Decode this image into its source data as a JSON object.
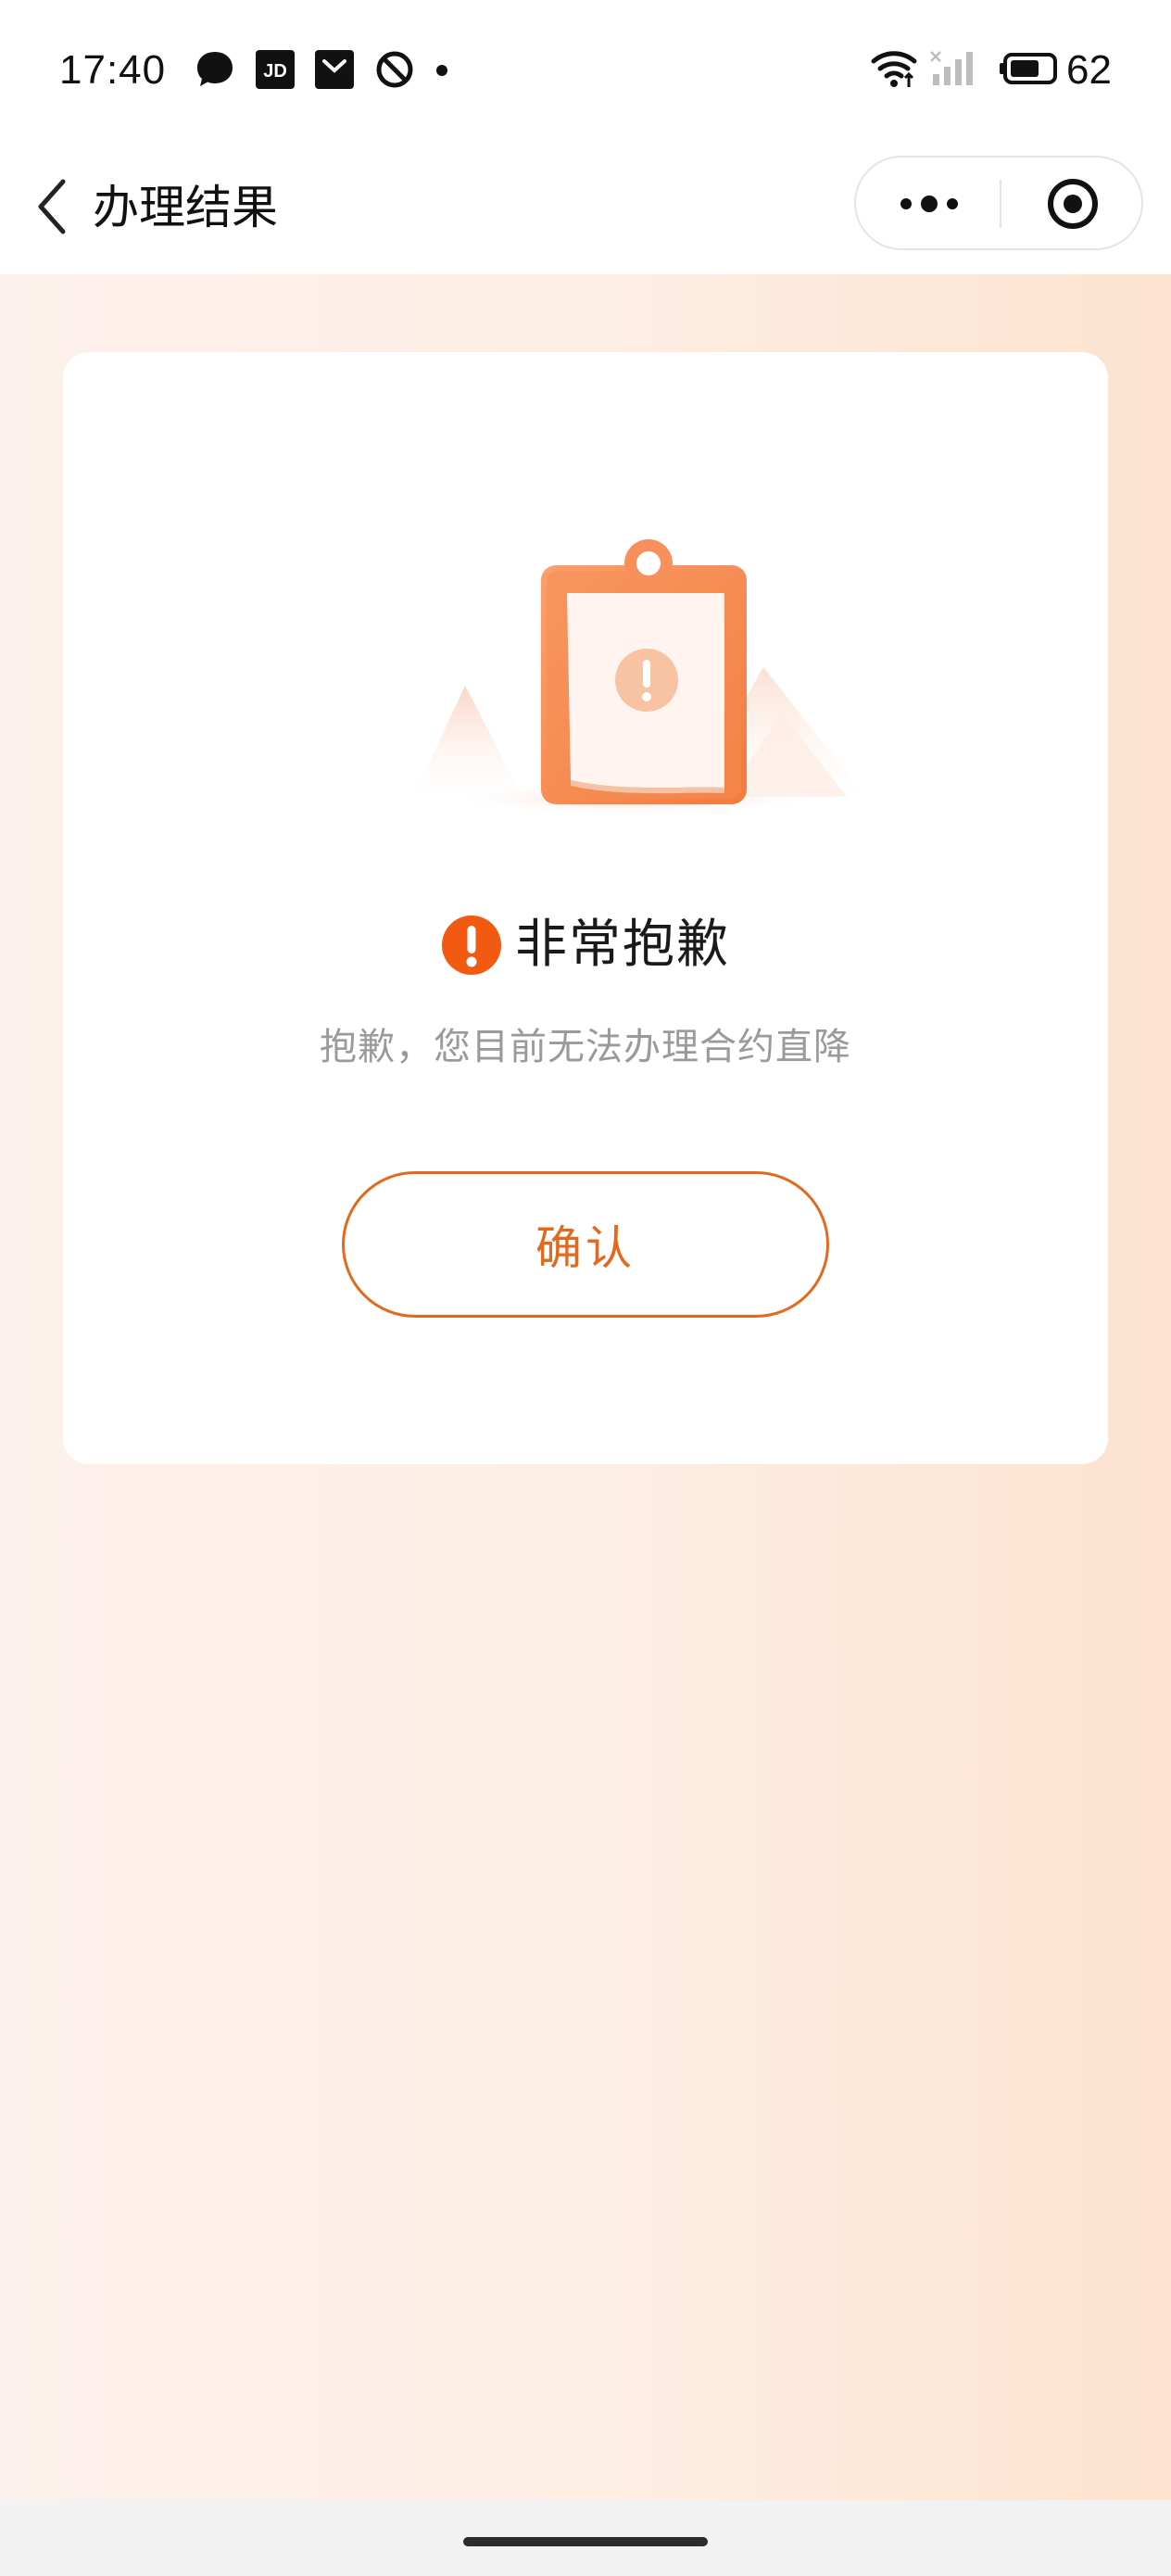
{
  "status_bar": {
    "time": "17:40",
    "notification_icons": [
      "chat-bubble-icon",
      "jd-app-icon",
      "shopping-bag-icon",
      "do-not-disturb-icon",
      "dot-icon"
    ],
    "jd_label": "JD",
    "battery_percent": "62"
  },
  "nav": {
    "title": "办理结果",
    "back_icon": "chevron-left-icon",
    "more_icon": "more-dots-icon",
    "close_icon": "target-circle-icon"
  },
  "result": {
    "title": "非常抱歉",
    "description": "抱歉，您目前无法办理合约直降",
    "confirm_label": "确认"
  },
  "colors": {
    "accent": "#e36a1c",
    "warning": "#f25a12",
    "illustration_orange": "#f7905a",
    "background_left": "#fdf1ed",
    "background_right": "#fde3cf",
    "description_text": "#9a9a9a"
  }
}
